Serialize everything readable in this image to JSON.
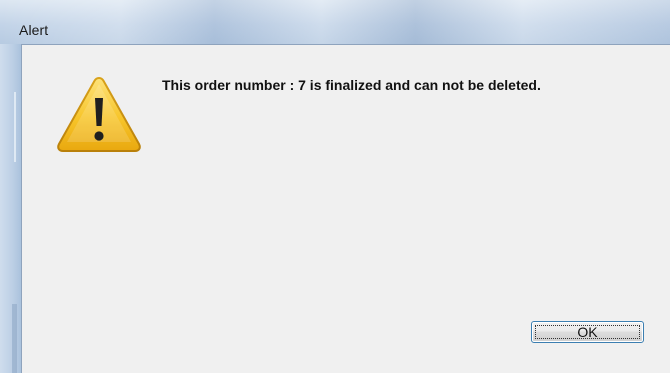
{
  "window": {
    "title": "Alert"
  },
  "dialog": {
    "icon": "warning-icon",
    "message": "This order number : 7 is finalized and can not be deleted.",
    "ok_label": "OK"
  },
  "colors": {
    "client_background": "#f0f0f0",
    "button_border": "#3c7fb1",
    "warning_yellow": "#f5c21b"
  }
}
